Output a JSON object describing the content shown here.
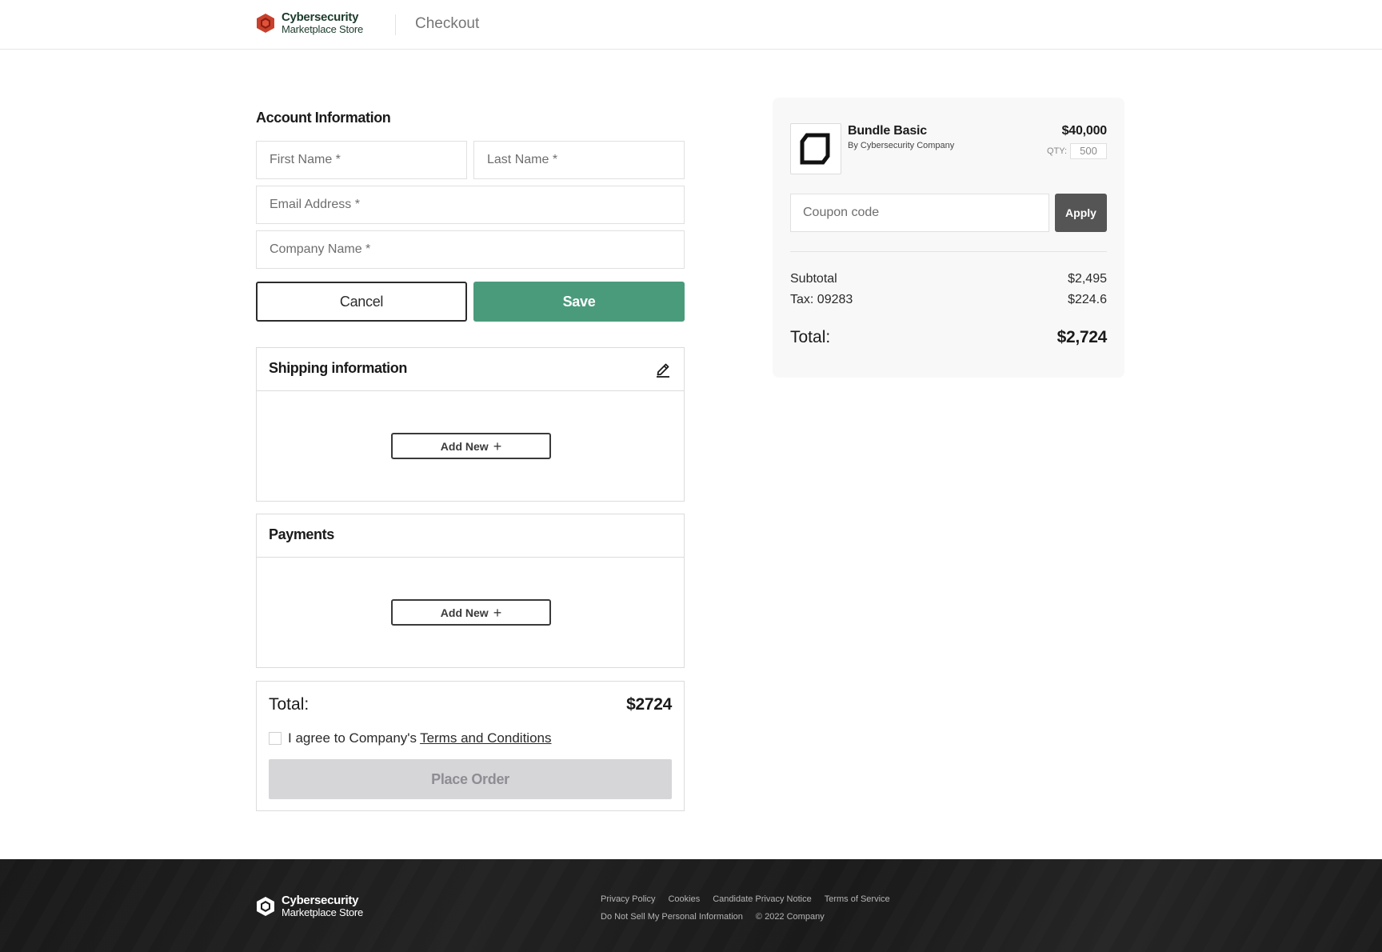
{
  "header": {
    "brand_line1": "Cybersecurity",
    "brand_line2": "Marketplace Store",
    "page_title": "Checkout"
  },
  "account": {
    "title": "Account Information",
    "first_name_placeholder": "First Name *",
    "last_name_placeholder": "Last Name *",
    "email_placeholder": "Email Address *",
    "company_placeholder": "Company Name *",
    "cancel_label": "Cancel",
    "save_label": "Save"
  },
  "shipping": {
    "title": "Shipping information",
    "add_new_label": "Add New",
    "edit_icon": "pencil-icon"
  },
  "payments": {
    "title": "Payments",
    "add_new_label": "Add New"
  },
  "order": {
    "total_label": "Total:",
    "total_value": "$2724",
    "agree_text": "I agree to Company's",
    "terms_link": "Terms and Conditions",
    "place_order_label": "Place Order"
  },
  "summary": {
    "product_name": "Bundle Basic",
    "product_by": "By Cybersecurity Company",
    "product_price": "$40,000",
    "qty_label": "QTY:",
    "qty_value": "500",
    "coupon_placeholder": "Coupon code",
    "apply_label": "Apply",
    "subtotal_label": "Subtotal",
    "subtotal_value": "$2,495",
    "tax_label": "Tax: 09283",
    "tax_value": "$224.6",
    "total_label": "Total:",
    "total_value": "$2,724"
  },
  "footer": {
    "brand_line1": "Cybersecurity",
    "brand_line2": "Marketplace Store",
    "links_row1": [
      "Privacy Policy",
      "Cookies",
      "Candidate Privacy Notice",
      "Terms of Service"
    ],
    "links_row2": [
      "Do Not Sell My Personal Information"
    ],
    "copyright": "© 2022 Company"
  },
  "colors": {
    "accent_green": "#4a9b7c",
    "brand_dark_green": "#1d3b2c",
    "logo_red": "#c0392b",
    "apply_gray": "#555555",
    "disabled_gray": "#d6d6d9"
  }
}
